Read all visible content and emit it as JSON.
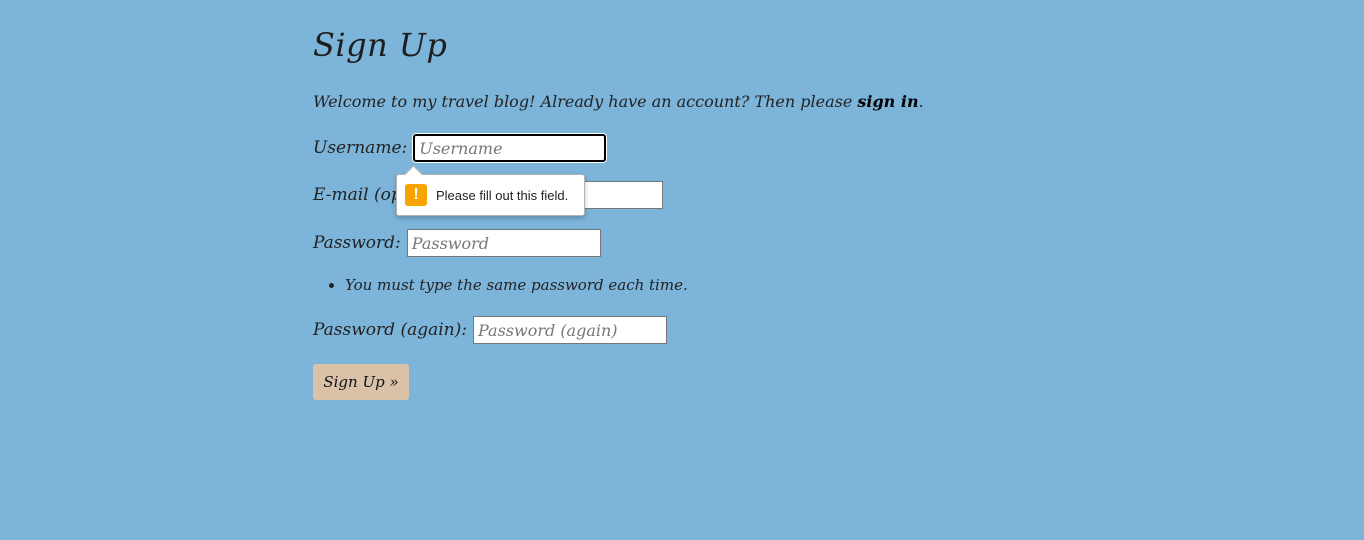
{
  "page": {
    "title": "Sign Up",
    "intro_text": "Welcome to my travel blog! Already have an account? Then please ",
    "sign_in_link": "sign in",
    "intro_end": "."
  },
  "form": {
    "username": {
      "label": "Username:",
      "placeholder": "Username",
      "value": ""
    },
    "email": {
      "label": "E-mail (optional):",
      "placeholder": "",
      "value": ""
    },
    "password": {
      "label": "Password:",
      "placeholder": "Password",
      "value": ""
    },
    "password_help": "You must type the same password each time.",
    "password2": {
      "label": "Password (again):",
      "placeholder": "Password (again)",
      "value": ""
    },
    "submit_label": "Sign Up »"
  },
  "validation_tooltip": {
    "icon": "warning-icon",
    "icon_glyph": "!",
    "message": "Please fill out this field.",
    "icon_color": "#f7a300"
  },
  "colors": {
    "background": "#7db4d9",
    "button": "#d9c2a8"
  }
}
